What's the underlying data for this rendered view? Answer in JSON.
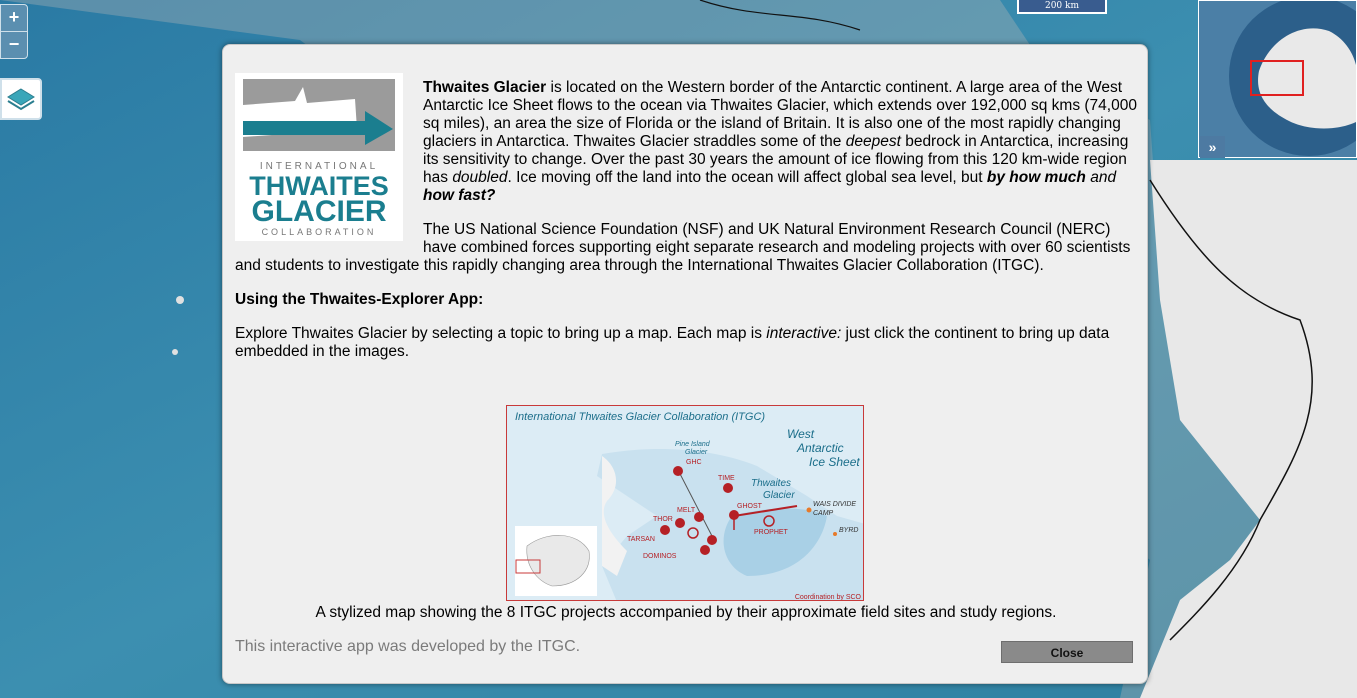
{
  "map": {
    "zoom_in_label": "+",
    "zoom_out_label": "−",
    "scale_label": "200 km",
    "overview_toggle_label": "»",
    "colors": {
      "ocean": "#2f7ea2",
      "ice": "#dcdcdc",
      "button": "#5b8fb0"
    }
  },
  "logo": {
    "line1": "INTERNATIONAL",
    "line2": "THWAITES",
    "line3": "GLACIER",
    "line4": "COLLABORATION"
  },
  "intro": {
    "p1_bold": "Thwaites Glacier",
    "p1_a": " is located on the Western border of the Antarctic continent. A large area of the West Antarctic Ice Sheet flows to the ocean via Thwaites Glacier, which extends over 192,000 sq kms (74,000 sq miles), an area the size of Florida or the island of Britain. It is also one of the most rapidly changing glaciers in Antarctica. Thwaites Glacier straddles some of the ",
    "p1_em1": "deepest",
    "p1_b": " bedrock in Antarctica, increasing its sensitivity to change. Over the past 30 years the amount of ice flowing from this 120 km-wide region has ",
    "p1_em2": "doubled",
    "p1_c": ". Ice moving off the land into the ocean will affect global sea level, but ",
    "p1_strong1": "by how much",
    "p1_and": " and ",
    "p1_strong2": "how fast?",
    "p2": "The US National Science Foundation (NSF) and UK Natural Environment Research Council (NERC) have combined forces supporting eight separate research and modeling projects with over 60 scientists and students to investigate this rapidly changing area through the International Thwaites Glacier Collaboration (ITGC)."
  },
  "usage": {
    "heading": "Using the Thwaites-Explorer App:",
    "text_a": "Explore Thwaites Glacier by selecting a topic to bring up a map. Each map is ",
    "text_em": "interactive:",
    "text_b": " just click the continent to bring up data embedded in the images."
  },
  "figure": {
    "title": "International Thwaites Glacier Collaboration (ITGC)",
    "region": [
      "West",
      "Antarctic",
      "Ice Sheet"
    ],
    "pine_island": [
      "Pine Island",
      "Glacier"
    ],
    "thwaites": [
      "Thwaites",
      "Glacier"
    ],
    "wais": [
      "WAIS DIVIDE",
      "CAMP"
    ],
    "byrd": "BYRD",
    "projects": [
      "GHC",
      "TIME",
      "MELT",
      "GHOST",
      "THOR",
      "TARSAN",
      "DOMINOS",
      "PROPHET"
    ],
    "credit": "Coordination by SCO",
    "caption": "A stylized map showing the 8 ITGC projects accompanied by their approximate field sites and study regions."
  },
  "footer": {
    "note": "This interactive app was developed by the ITGC.",
    "close_label": "Close"
  }
}
